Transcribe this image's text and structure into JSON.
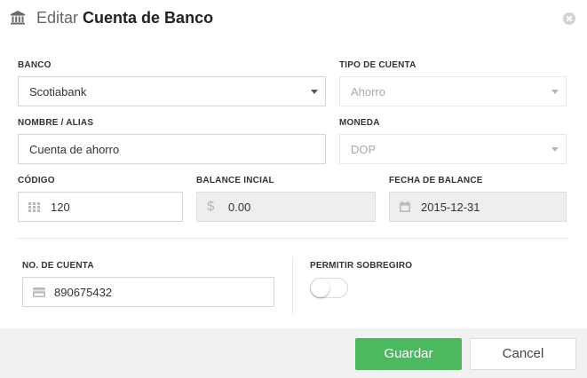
{
  "dialog": {
    "title_prefix": "Editar",
    "title_main": "Cuenta de Banco",
    "icons": {
      "header": "bank-icon",
      "close": "close-circle-icon"
    }
  },
  "form": {
    "banco": {
      "label": "BANCO",
      "value": "Scotiabank"
    },
    "tipo_cuenta": {
      "label": "TIPO DE CUENTA",
      "value": "Ahorro"
    },
    "nombre_alias": {
      "label": "NOMBRE / ALIAS",
      "value": "Cuenta de ahorro"
    },
    "moneda": {
      "label": "MONEDA",
      "value": "DOP"
    },
    "codigo": {
      "label": "CÓDIGO",
      "value": "120",
      "icon": "grid-icon"
    },
    "balance_inicial": {
      "label": "BALANCE INCIAL",
      "value": "0.00",
      "icon": "dollar-icon"
    },
    "fecha_balance": {
      "label": "FECHA DE BALANCE",
      "value": "2015-12-31",
      "icon": "calendar-icon"
    },
    "no_cuenta": {
      "label": "NO. DE CUENTA",
      "value": "890675432",
      "icon": "credit-card-icon"
    },
    "permitir_sobregiro": {
      "label": "PERMITIR SOBREGIRO",
      "enabled": false
    }
  },
  "footer": {
    "save_label": "Guardar",
    "cancel_label": "Cancel",
    "save_color": "#4cb860"
  }
}
